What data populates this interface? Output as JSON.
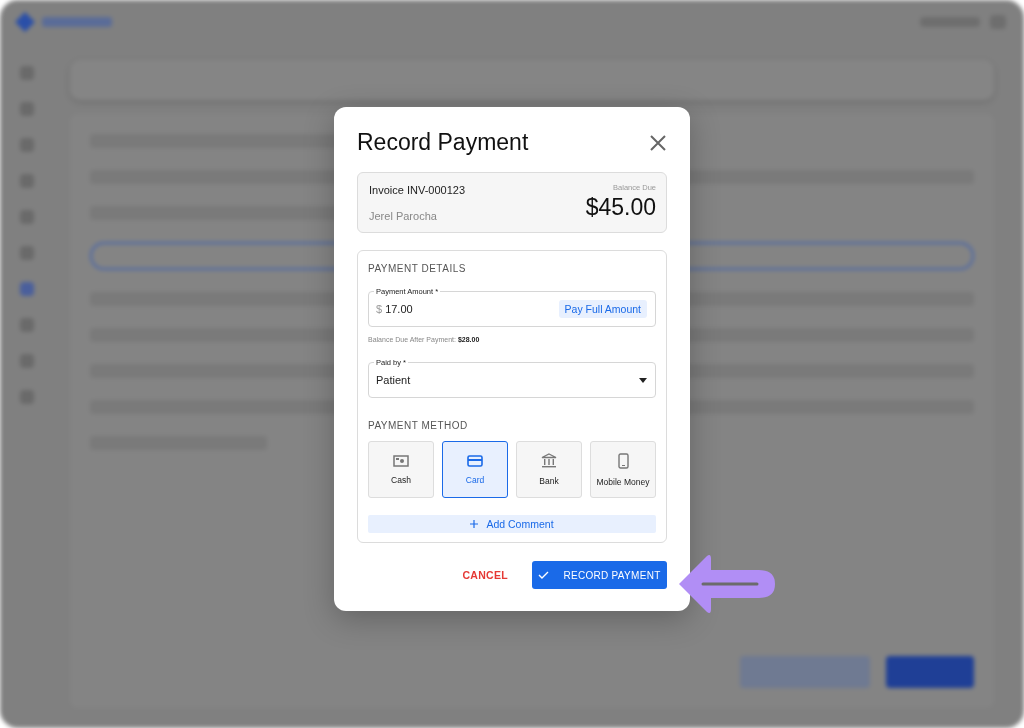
{
  "dialog": {
    "title": "Record Payment"
  },
  "invoice": {
    "number": "Invoice INV-000123",
    "patient": "Jerel Parocha",
    "balance_label": "Balance Due",
    "balance": "$45.00"
  },
  "payment_details": {
    "heading": "PAYMENT DETAILS",
    "amount_field": {
      "label": "Payment Amount *",
      "currency": "$",
      "value": "17.00",
      "action": "Pay Full Amount"
    },
    "balance_after": {
      "label": "Balance Due After Payment:",
      "value": "$28.00"
    },
    "paid_by": {
      "label": "Paid by *",
      "value": "Patient"
    }
  },
  "payment_method": {
    "heading": "PAYMENT METHOD",
    "options": [
      {
        "label": "Cash",
        "kind": "cash",
        "selected": false
      },
      {
        "label": "Card",
        "kind": "card",
        "selected": true
      },
      {
        "label": "Bank",
        "kind": "bank",
        "selected": false
      },
      {
        "label": "Mobile Money",
        "kind": "mobile",
        "selected": false
      }
    ]
  },
  "add_comment": "Add Comment",
  "buttons": {
    "cancel": "CANCEL",
    "record": "RECORD PAYMENT"
  }
}
